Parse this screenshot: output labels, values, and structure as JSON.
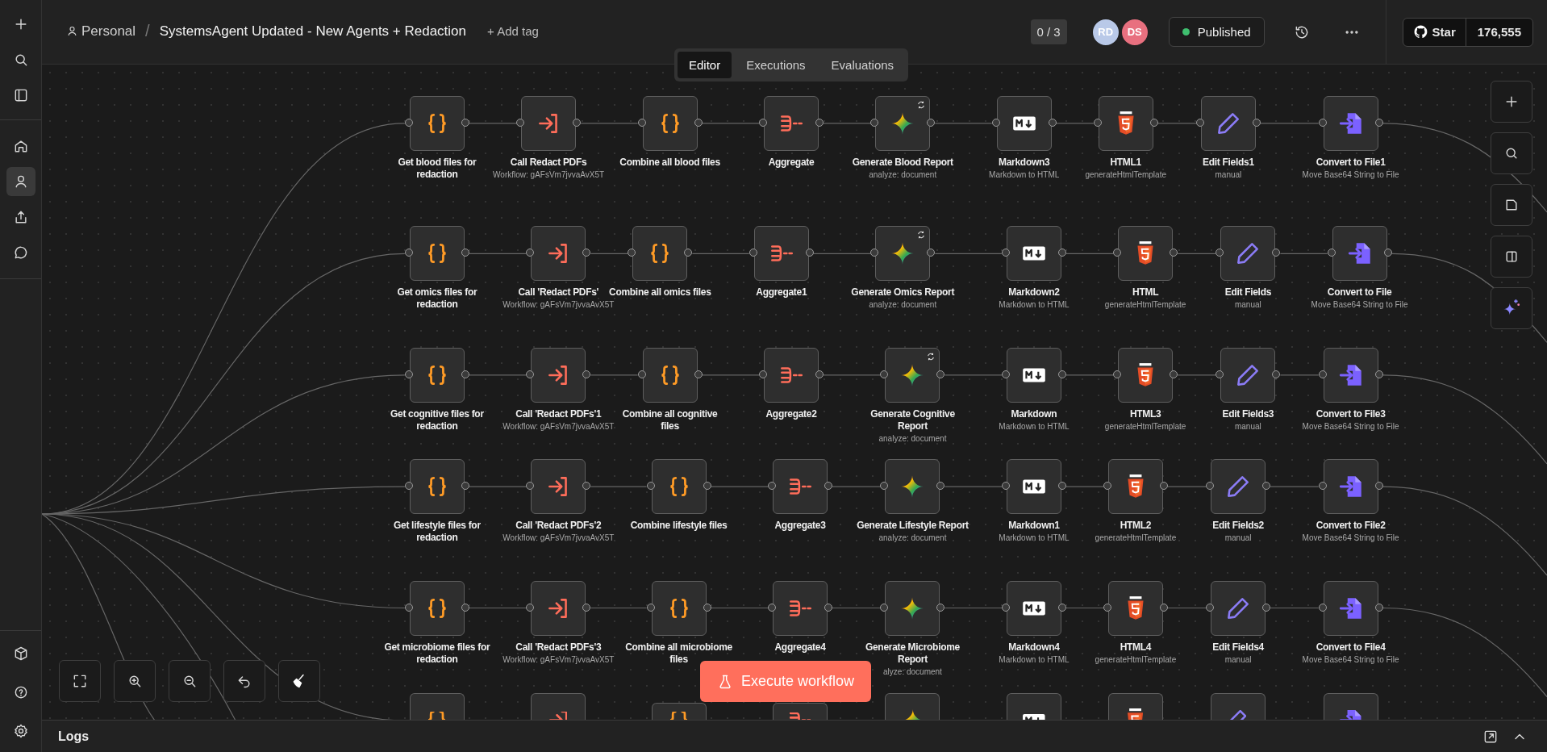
{
  "sidebar": {
    "nav": [
      {
        "kind": "home",
        "selected": false
      },
      {
        "kind": "user",
        "selected": true
      },
      {
        "kind": "upload",
        "selected": false
      },
      {
        "kind": "chat",
        "selected": false
      }
    ]
  },
  "header": {
    "project": "Personal",
    "separator": "/",
    "title": "SystemsAgent Updated - New Agents + Redaction",
    "add_tag": "+ Add tag",
    "counter": "0 / 3",
    "avatars": [
      {
        "initials": "RD",
        "color": "#b9c9e8"
      },
      {
        "initials": "DS",
        "color": "#e8707f"
      }
    ],
    "status": {
      "label": "Published",
      "active": true
    },
    "github": {
      "label": "Star",
      "count": "176,555"
    }
  },
  "tabs": [
    {
      "label": "Editor",
      "selected": true
    },
    {
      "label": "Executions",
      "selected": false
    },
    {
      "label": "Evaluations",
      "selected": false
    }
  ],
  "rows": [
    {
      "nodes": [
        {
          "kind": "code",
          "name": "Get blood files for redaction",
          "refresh": false
        },
        {
          "kind": "exec",
          "name": "Call Redact PDFs",
          "subtitle": "Workflow: gAFsVm7jvvaAvX5T",
          "refresh": false
        },
        {
          "kind": "code",
          "name": "Combine all blood files",
          "refresh": false
        },
        {
          "kind": "aggregate",
          "name": "Aggregate",
          "refresh": false
        },
        {
          "kind": "gemini",
          "name": "Generate Blood Report",
          "subtitle": "analyze: document",
          "refresh": true
        },
        {
          "kind": "markdown",
          "name": "Markdown3",
          "subtitle": "Markdown to HTML",
          "refresh": false
        },
        {
          "kind": "html",
          "name": "HTML1",
          "subtitle": "generateHtmlTemplate",
          "refresh": false
        },
        {
          "kind": "edit",
          "name": "Edit Fields1",
          "subtitle": "manual",
          "refresh": false
        },
        {
          "kind": "convert",
          "name": "Convert to File1",
          "subtitle": "Move Base64 String to File",
          "refresh": false
        }
      ]
    },
    {
      "nodes": [
        {
          "kind": "code",
          "name": "Get omics files for redaction",
          "refresh": false
        },
        {
          "kind": "exec",
          "name": "Call 'Redact PDFs'",
          "subtitle": "Workflow: gAFsVm7jvvaAvX5T",
          "refresh": false
        },
        {
          "kind": "code",
          "name": "Combine all omics files",
          "refresh": false
        },
        {
          "kind": "aggregate",
          "name": "Aggregate1",
          "refresh": false
        },
        {
          "kind": "gemini",
          "name": "Generate Omics Report",
          "subtitle": "analyze: document",
          "refresh": true
        },
        {
          "kind": "markdown",
          "name": "Markdown2",
          "subtitle": "Markdown to HTML",
          "refresh": false
        },
        {
          "kind": "html",
          "name": "HTML",
          "subtitle": "generateHtmlTemplate",
          "refresh": false
        },
        {
          "kind": "edit",
          "name": "Edit Fields",
          "subtitle": "manual",
          "refresh": false
        },
        {
          "kind": "convert",
          "name": "Convert to File",
          "subtitle": "Move Base64 String to File",
          "refresh": false
        }
      ]
    },
    {
      "nodes": [
        {
          "kind": "code",
          "name": "Get cognitive files for redaction",
          "refresh": false
        },
        {
          "kind": "exec",
          "name": "Call 'Redact PDFs'1",
          "subtitle": "Workflow: gAFsVm7jvvaAvX5T",
          "refresh": false
        },
        {
          "kind": "code",
          "name": "Combine all cognitive files",
          "refresh": false
        },
        {
          "kind": "aggregate",
          "name": "Aggregate2",
          "refresh": false
        },
        {
          "kind": "gemini",
          "name": "Generate Cognitive Report",
          "subtitle": "analyze: document",
          "refresh": true
        },
        {
          "kind": "markdown",
          "name": "Markdown",
          "subtitle": "Markdown to HTML",
          "refresh": false
        },
        {
          "kind": "html",
          "name": "HTML3",
          "subtitle": "generateHtmlTemplate",
          "refresh": false
        },
        {
          "kind": "edit",
          "name": "Edit Fields3",
          "subtitle": "manual",
          "refresh": false
        },
        {
          "kind": "convert",
          "name": "Convert to File3",
          "subtitle": "Move Base64 String to File",
          "refresh": false
        }
      ]
    },
    {
      "nodes": [
        {
          "kind": "code",
          "name": "Get lifestyle files for redaction",
          "refresh": false
        },
        {
          "kind": "exec",
          "name": "Call 'Redact PDFs'2",
          "subtitle": "Workflow: gAFsVm7jvvaAvX5T",
          "refresh": false
        },
        {
          "kind": "code",
          "name": "Combine lifestyle files",
          "refresh": false
        },
        {
          "kind": "aggregate",
          "name": "Aggregate3",
          "refresh": false
        },
        {
          "kind": "gemini",
          "name": "Generate Lifestyle Report",
          "subtitle": "analyze: document",
          "refresh": false
        },
        {
          "kind": "markdown",
          "name": "Markdown1",
          "subtitle": "Markdown to HTML",
          "refresh": false
        },
        {
          "kind": "html",
          "name": "HTML2",
          "subtitle": "generateHtmlTemplate",
          "refresh": false
        },
        {
          "kind": "edit",
          "name": "Edit Fields2",
          "subtitle": "manual",
          "refresh": false
        },
        {
          "kind": "convert",
          "name": "Convert to File2",
          "subtitle": "Move Base64 String to File",
          "refresh": false
        }
      ]
    },
    {
      "nodes": [
        {
          "kind": "code",
          "name": "Get microbiome files for redaction",
          "refresh": false
        },
        {
          "kind": "exec",
          "name": "Call 'Redact PDFs'3",
          "subtitle": "Workflow: gAFsVm7jvvaAvX5T",
          "refresh": false
        },
        {
          "kind": "code",
          "name": "Combine all microbiome files",
          "refresh": false
        },
        {
          "kind": "aggregate",
          "name": "Aggregate4",
          "refresh": false
        },
        {
          "kind": "gemini",
          "name": "Generate Microbiome Report",
          "subtitle": "alyze: document",
          "refresh": false
        },
        {
          "kind": "markdown",
          "name": "Markdown4",
          "subtitle": "Markdown to HTML",
          "refresh": false
        },
        {
          "kind": "html",
          "name": "HTML4",
          "subtitle": "generateHtmlTemplate",
          "refresh": false
        },
        {
          "kind": "edit",
          "name": "Edit Fields4",
          "subtitle": "manual",
          "refresh": false
        },
        {
          "kind": "convert",
          "name": "Convert to File4",
          "subtitle": "Move Base64 String to File",
          "refresh": false
        }
      ]
    },
    {
      "nodes": [
        {
          "kind": "code"
        },
        {
          "kind": "exec"
        },
        {
          "kind": "code"
        },
        {
          "kind": "aggregate"
        },
        {
          "kind": "gemini"
        },
        {
          "kind": "markdown"
        },
        {
          "kind": "html"
        },
        {
          "kind": "edit"
        },
        {
          "kind": "convert"
        }
      ]
    }
  ],
  "execute": {
    "label": "Execute workflow"
  },
  "logs": {
    "label": "Logs"
  }
}
